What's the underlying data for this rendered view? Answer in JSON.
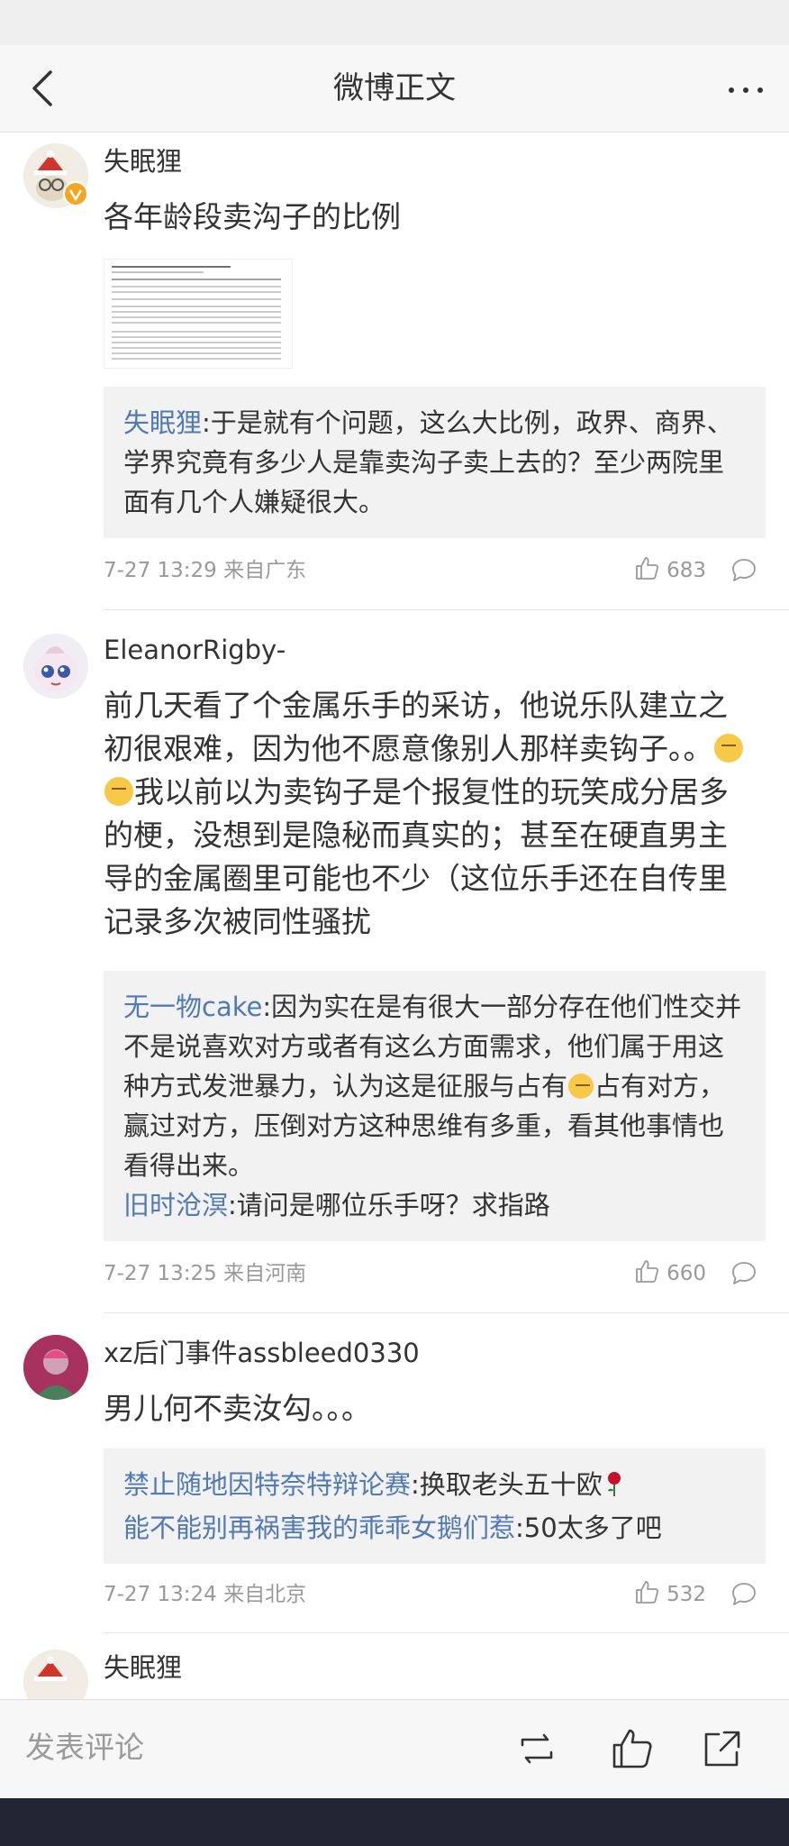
{
  "nav": {
    "title": "微博正文"
  },
  "comments": [
    {
      "username": "失眠狸",
      "text": "各年龄段卖沟子的比例",
      "has_image": true,
      "replies": [
        {
          "user": "失眠狸",
          "text": ":于是就有个问题，这么大比例，政界、商界、学界究竟有多少人是靠卖沟子卖上去的？至少两院里面有几个人嫌疑很大。"
        }
      ],
      "time": "7-27 13:29 来自广东",
      "likes": "683"
    },
    {
      "username": "EleanorRigby-",
      "text_part1": "前几天看了个金属乐手的采访，他说乐队建立之初很艰难，因为他不愿意像别人那样卖钩子。。",
      "text_part2": "我以前以为卖钩子是个报复性的玩笑成分居多的梗，没想到是隐秘而真实的；甚至在硬直男主导的金属圈里可能也不少（这位乐手还在自传里记录多次被同性骚扰",
      "replies": [
        {
          "user": "无一物cake",
          "text_part1": ":因为实在是有很大一部分存在他们性交并不是说喜欢对方或者有这么方面需求，他们属于用这种方式发泄暴力，认为这是征服与占有",
          "text_part2": "占有对方，赢过对方，压倒对方这种思维有多重，看其他事情也看得出来。"
        },
        {
          "user": "旧时沧溟",
          "text": ":请问是哪位乐手呀？求指路"
        }
      ],
      "time": "7-27 13:25 来自河南",
      "likes": "660"
    },
    {
      "username": "xz后门事件assbleed0330",
      "text": "男儿何不卖汝勾。。。",
      "replies": [
        {
          "user": "禁止随地因特奈特辩论赛",
          "text": ":换取老头五十欧"
        },
        {
          "user": "能不能别再祸害我的乖乖女鹅们惹",
          "text": ":50太多了吧"
        }
      ],
      "time": "7-27 13:24 来自北京",
      "likes": "532"
    },
    {
      "username": "失眠狸"
    }
  ],
  "bottom": {
    "placeholder": "发表评论"
  },
  "colors": {
    "link": "#5079b5",
    "meta": "#999999",
    "verified_badge": "#f5a623"
  },
  "icons": [
    "back-arrow-icon",
    "more-icon",
    "like-icon",
    "reply-icon",
    "repost-icon",
    "share-icon",
    "verified-badge-icon",
    "rose-icon"
  ]
}
